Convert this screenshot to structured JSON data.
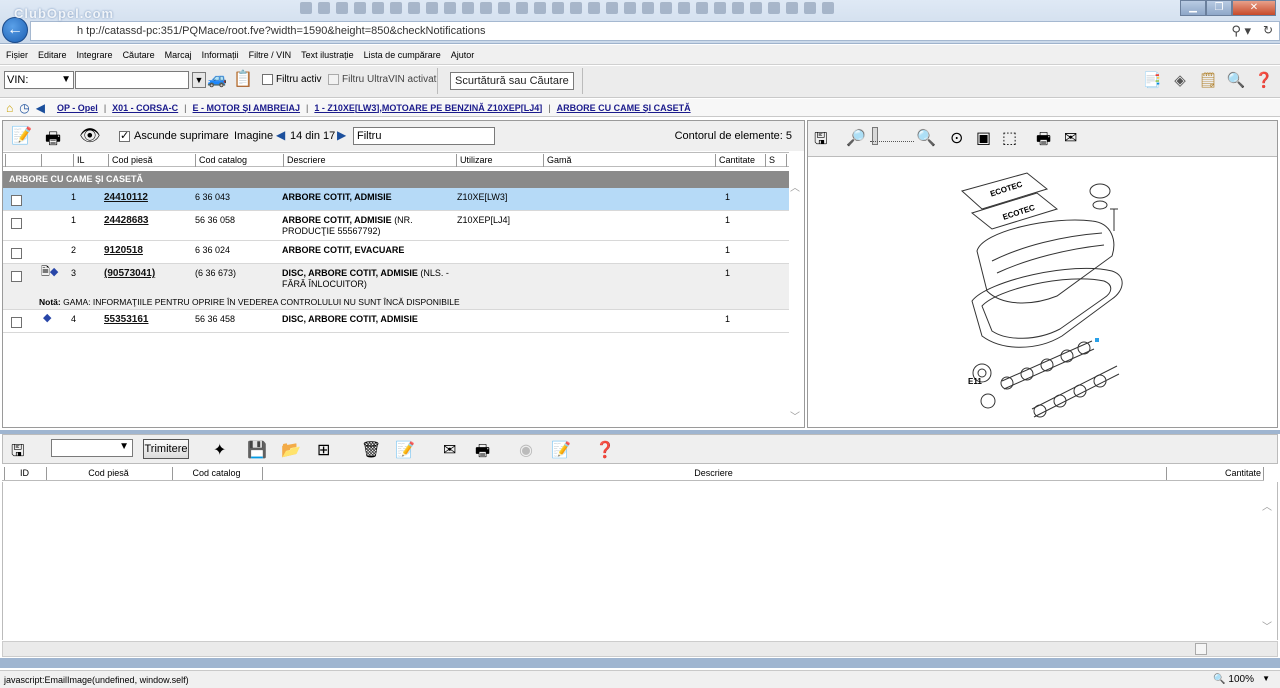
{
  "browser": {
    "watermark": "ClubOpel.com",
    "url": "h tp://catassd-pc:351/PQMace/root.fve?width=1590&height=850&checkNotifications"
  },
  "menu": [
    "Fișier",
    "Editare",
    "Integrare",
    "Căutare",
    "Marcaj",
    "Informații",
    "Filtre / VIN",
    "Text ilustrație",
    "Lista de cumpărare",
    "Ajutor"
  ],
  "toolbar": {
    "vin_label": "VIN:",
    "filter_active": "Filtru activ",
    "filter_ultravin": "Filtru UltraVIN activat",
    "shortcut_placeholder": "Scurtătură sau Căutare"
  },
  "breadcrumb": [
    "OP - Opel",
    "X01 - CORSA-C",
    "E - MOTOR ŞI AMBREIAJ",
    "1 - Z10XE[LW3],MOTOARE PE BENZINĂ Z10XEP[LJ4]",
    "ARBORE CU CAME ŞI CASETĂ"
  ],
  "parts": {
    "hide_deleted": "Ascunde suprimare",
    "image_label": "Imagine",
    "image_counter": "14 din 17",
    "filter_placeholder": "Filtru",
    "element_count": "Contorul de elemente: 5",
    "columns": [
      "IL",
      "Cod piesă",
      "Cod catalog",
      "Descriere",
      "Utilizare",
      "Gamă",
      "Cantitate",
      "S"
    ],
    "group": "ARBORE CU CAME ŞI CASETĂ",
    "rows": [
      {
        "il": "1",
        "code": "24410112",
        "catalog": "6 36 043",
        "desc": "ARBORE COTIT, ADMISIE",
        "desc_extra": "",
        "usage": "Z10XE[LW3]",
        "qty": "1"
      },
      {
        "il": "1",
        "code": "24428683",
        "catalog": "56 36 058",
        "desc": "ARBORE COTIT, ADMISIE",
        "desc_extra": "(NR. PRODUCŢIE 55567792)",
        "usage": "Z10XEP[LJ4]",
        "qty": "1"
      },
      {
        "il": "2",
        "code": "9120518",
        "catalog": "6 36 024",
        "desc": "ARBORE COTIT, EVACUARE",
        "desc_extra": "",
        "usage": "",
        "qty": "1"
      },
      {
        "il": "3",
        "code": "(90573041)",
        "catalog": "(6 36 673)",
        "desc": "DISC, ARBORE COTIT, ADMISIE",
        "desc_extra": "(NLS. - FĂRĂ ÎNLOCUITOR)",
        "usage": "",
        "qty": "1"
      },
      {
        "il": "4",
        "code": "55353161",
        "catalog": "56 36 458",
        "desc": "DISC, ARBORE COTIT, ADMISIE",
        "desc_extra": "",
        "usage": "",
        "qty": "1"
      }
    ],
    "note_label": "Notă:",
    "note_text": "GAMA: INFORMAŢIILE PENTRU OPRIRE ÎN VEDEREA CONTROLULUI NU SUNT ÎNCĂ DISPONIBILE"
  },
  "diagram": {
    "code": "E11",
    "brand1": "ECOTEC",
    "brand2": "ECOTEC"
  },
  "basket": {
    "send_label": "Trimitere",
    "columns": [
      "ID",
      "Cod piesă",
      "Cod catalog",
      "Descriere",
      "Cantitate"
    ]
  },
  "status": {
    "text": "javascript:EmailImage(undefined, window.self)",
    "zoom": "100%"
  }
}
